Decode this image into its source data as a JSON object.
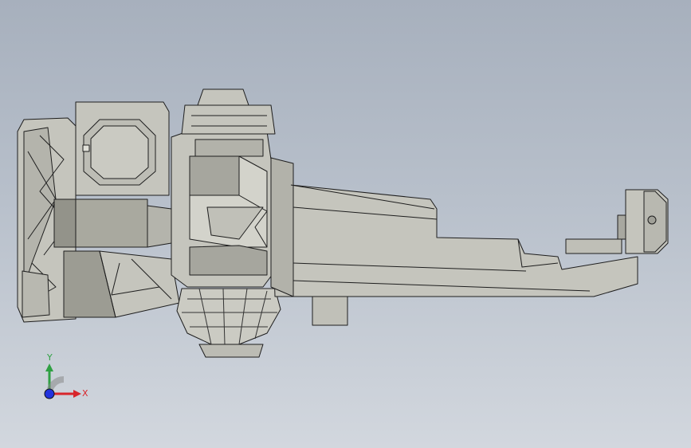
{
  "viewport": {
    "background_top": "#a7b0bd",
    "background_bottom": "#d2d7de"
  },
  "model": {
    "fill": "#c5c5bd",
    "fill_dark": "#a6a69e",
    "edge": "#1e1e1e"
  },
  "triad": {
    "y_label": "Y",
    "x_label": "X",
    "y_color": "#2fa043",
    "x_color": "#d8252b",
    "z_color": "#2233dd",
    "icon": "coordinate-triad-icon"
  }
}
